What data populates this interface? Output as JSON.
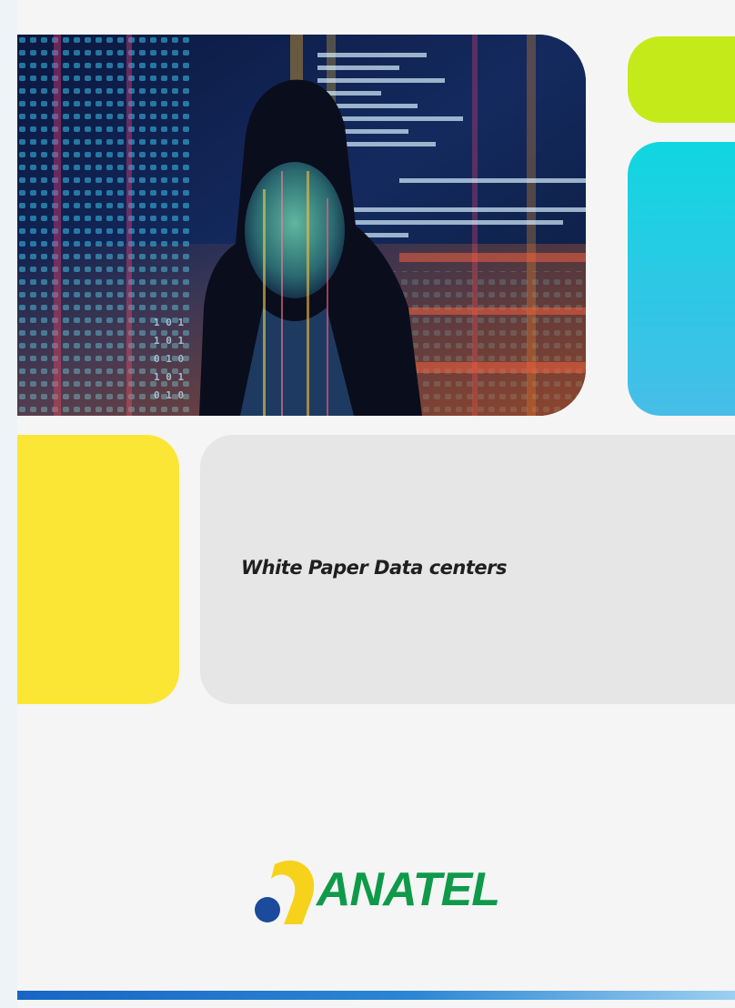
{
  "cover": {
    "title": "White Paper Data centers",
    "photo_description_icon": "person-with-code-projection-image"
  },
  "logo": {
    "wordmark": "ANATEL",
    "icon": "anatel-emblem-icon"
  },
  "colors": {
    "green_block": "#c4ea1a",
    "cyan_block": "#1fd0e3",
    "yellow_block": "#fbe635",
    "title_panel": "#e6e6e6",
    "logo_green": "#0f9a4a",
    "logo_blue": "#1c4a9c",
    "logo_yellow": "#f7d21a",
    "bottom_bar": "#1866c4"
  }
}
